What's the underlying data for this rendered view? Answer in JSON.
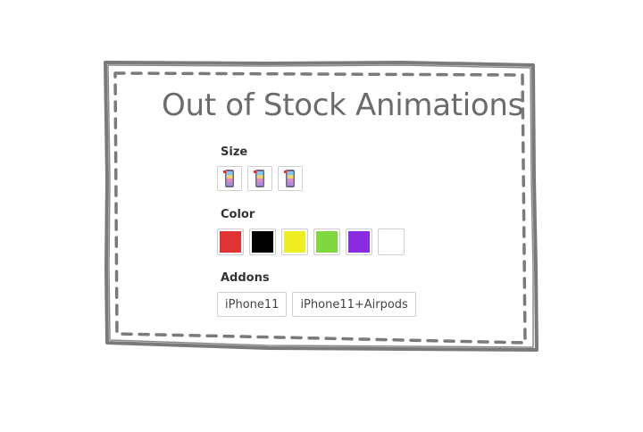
{
  "title": "Out of Stock Animations",
  "size": {
    "label": "Size",
    "options": [
      {
        "icon": "phone-icon"
      },
      {
        "icon": "phone-icon"
      },
      {
        "icon": "phone-icon"
      }
    ]
  },
  "color": {
    "label": "Color",
    "options": [
      {
        "name": "red",
        "hex": "#e03333"
      },
      {
        "name": "black",
        "hex": "#000000"
      },
      {
        "name": "yellow",
        "hex": "#eeee22"
      },
      {
        "name": "green",
        "hex": "#7fd83d"
      },
      {
        "name": "purple",
        "hex": "#8a2be2"
      },
      {
        "name": "white",
        "hex": "#ffffff"
      }
    ]
  },
  "addons": {
    "label": "Addons",
    "options": [
      {
        "label": "iPhone11"
      },
      {
        "label": "iPhone11+Airpods"
      }
    ]
  },
  "colors": {
    "frame": "#7a7a7a",
    "title": "#6b6b6b"
  }
}
